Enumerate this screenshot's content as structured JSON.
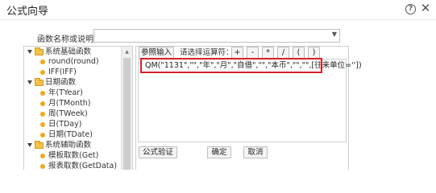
{
  "dialog": {
    "title": "公式向导"
  },
  "name_field": {
    "label": "函数名称或说明:",
    "value": ""
  },
  "tree": [
    {
      "kind": "folder",
      "label": "系统基础函数"
    },
    {
      "kind": "leaf",
      "label": "round(round)"
    },
    {
      "kind": "leaf",
      "label": "IFF(IFF)"
    },
    {
      "kind": "folder",
      "label": "日期函数"
    },
    {
      "kind": "leaf",
      "label": "年(TYear)"
    },
    {
      "kind": "leaf",
      "label": "月(TMonth)"
    },
    {
      "kind": "leaf",
      "label": "周(TWeek)"
    },
    {
      "kind": "leaf",
      "label": "日(TDay)"
    },
    {
      "kind": "leaf",
      "label": "日期(TDate)"
    },
    {
      "kind": "folder",
      "label": "系统辅助函数"
    },
    {
      "kind": "leaf",
      "label": "模板取数(Get)"
    },
    {
      "kind": "leaf",
      "label": "报表取数(GetData)"
    }
  ],
  "toolbar": {
    "ref_input_label": "参照输入",
    "operator_prompt": "请选择运算符：",
    "operators": [
      "+",
      "-",
      "*",
      "/",
      "(",
      ")"
    ]
  },
  "formula": {
    "text": "QM(\"1131\",\"\",\"年\",\"月\",\"自借\",\"\",\"本币\",\"\",\"\",[往来单位=''])"
  },
  "buttons": {
    "validate_label": "公式验证",
    "ok_label": "确定",
    "cancel_label": "取消"
  }
}
